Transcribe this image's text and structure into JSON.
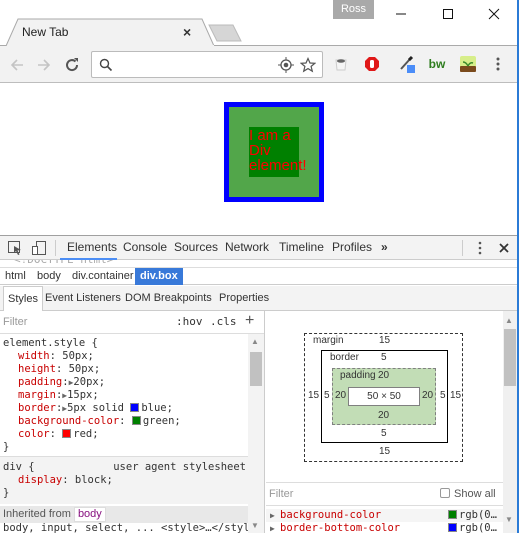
{
  "window": {
    "profile_name": "Ross",
    "controls": {
      "minimize": "minimize",
      "maximize": "maximize",
      "close": "close"
    }
  },
  "tabs": [
    {
      "title": "New Tab",
      "close_label": "×",
      "active": true
    }
  ],
  "toolbar": {
    "omnibox_value": "",
    "omnibox_placeholder": "",
    "icons": [
      "back-icon",
      "forward-icon",
      "reload-icon",
      "search-icon",
      "location-icon",
      "bookmark-star-icon"
    ],
    "extensions": [
      "coffee-cup-extension",
      "adblock-hand-extension",
      "color-picker-extension",
      "bw-extension",
      "plant-extension",
      "menu-dots"
    ],
    "bw_label": "bw"
  },
  "page": {
    "box_text": "I am a Div element!",
    "colors": {
      "border": "#0000ff",
      "padding_bg": "#52a64a",
      "content_bg": "#008000",
      "text": "#ff0000"
    }
  },
  "devtools": {
    "tabs": [
      {
        "label": "Elements",
        "active": true
      },
      {
        "label": "Console",
        "active": false
      },
      {
        "label": "Sources",
        "active": false
      },
      {
        "label": "Network",
        "active": false
      },
      {
        "label": "Timeline",
        "active": false
      },
      {
        "label": "Profiles",
        "active": false
      }
    ],
    "more_tabs": "»",
    "dom_peek": "<!DOCTYPE html>",
    "breadcrumbs": [
      {
        "label": "html",
        "active": false
      },
      {
        "label": "body",
        "active": false
      },
      {
        "label": "div.container",
        "active": false
      },
      {
        "label": "div.box",
        "active": true
      }
    ],
    "subtabs": [
      {
        "label": "Styles",
        "active": true
      },
      {
        "label": "Event Listeners",
        "active": false
      },
      {
        "label": "DOM Breakpoints",
        "active": false
      },
      {
        "label": "Properties",
        "active": false
      }
    ],
    "styles": {
      "filter_placeholder": "Filter",
      "hov": ":hov",
      "cls": ".cls",
      "add": "+",
      "element_style": {
        "selector": "element.style {",
        "props": [
          {
            "name": "width",
            "sep": ": ",
            "value": "50px;"
          },
          {
            "name": "height",
            "sep": ": ",
            "value": "50px;"
          },
          {
            "name": "padding",
            "sep": ":",
            "expand": "▶",
            "value": "20px;"
          },
          {
            "name": "margin",
            "sep": ":",
            "expand": "▶",
            "value": "15px;"
          },
          {
            "name": "border",
            "sep": ":",
            "expand": "▶",
            "value": "5px solid ",
            "swatch": "#0000ff",
            "swatch_value": "blue;"
          },
          {
            "name": "background-color",
            "sep": ": ",
            "value": "",
            "swatch": "#008000",
            "swatch_value": "green;"
          },
          {
            "name": "color",
            "sep": ": ",
            "value": "",
            "swatch": "#ff0000",
            "swatch_value": "red;"
          }
        ],
        "close": "}"
      },
      "ua_rule": {
        "selector": "div {",
        "origin": "user agent stylesheet",
        "prop_name": "display",
        "prop_value": ": block;",
        "close": "}"
      },
      "inherited_label": "Inherited from",
      "inherited_tag": "body",
      "next_rule": "body, input, select, ...    <style>…</style>"
    },
    "box_model": {
      "margin_label": "margin",
      "border_label": "border",
      "padding_label": "padding",
      "margin": {
        "top": "15",
        "right": "15",
        "bottom": "15",
        "left": "15"
      },
      "border": {
        "top": "5",
        "right": "5",
        "bottom": "5",
        "left": "5"
      },
      "padding": {
        "top": "20",
        "right": "20",
        "bottom": "20",
        "left": "20"
      },
      "content": "50 × 50"
    },
    "computed": {
      "filter_placeholder": "Filter",
      "show_all_label": "Show all",
      "show_all_checked": false,
      "rows": [
        {
          "name": "background-color",
          "swatch": "#008000",
          "value": "rgb(0…"
        },
        {
          "name": "border-bottom-color",
          "swatch": "#0000ff",
          "value": "rgb(0…"
        }
      ]
    }
  }
}
